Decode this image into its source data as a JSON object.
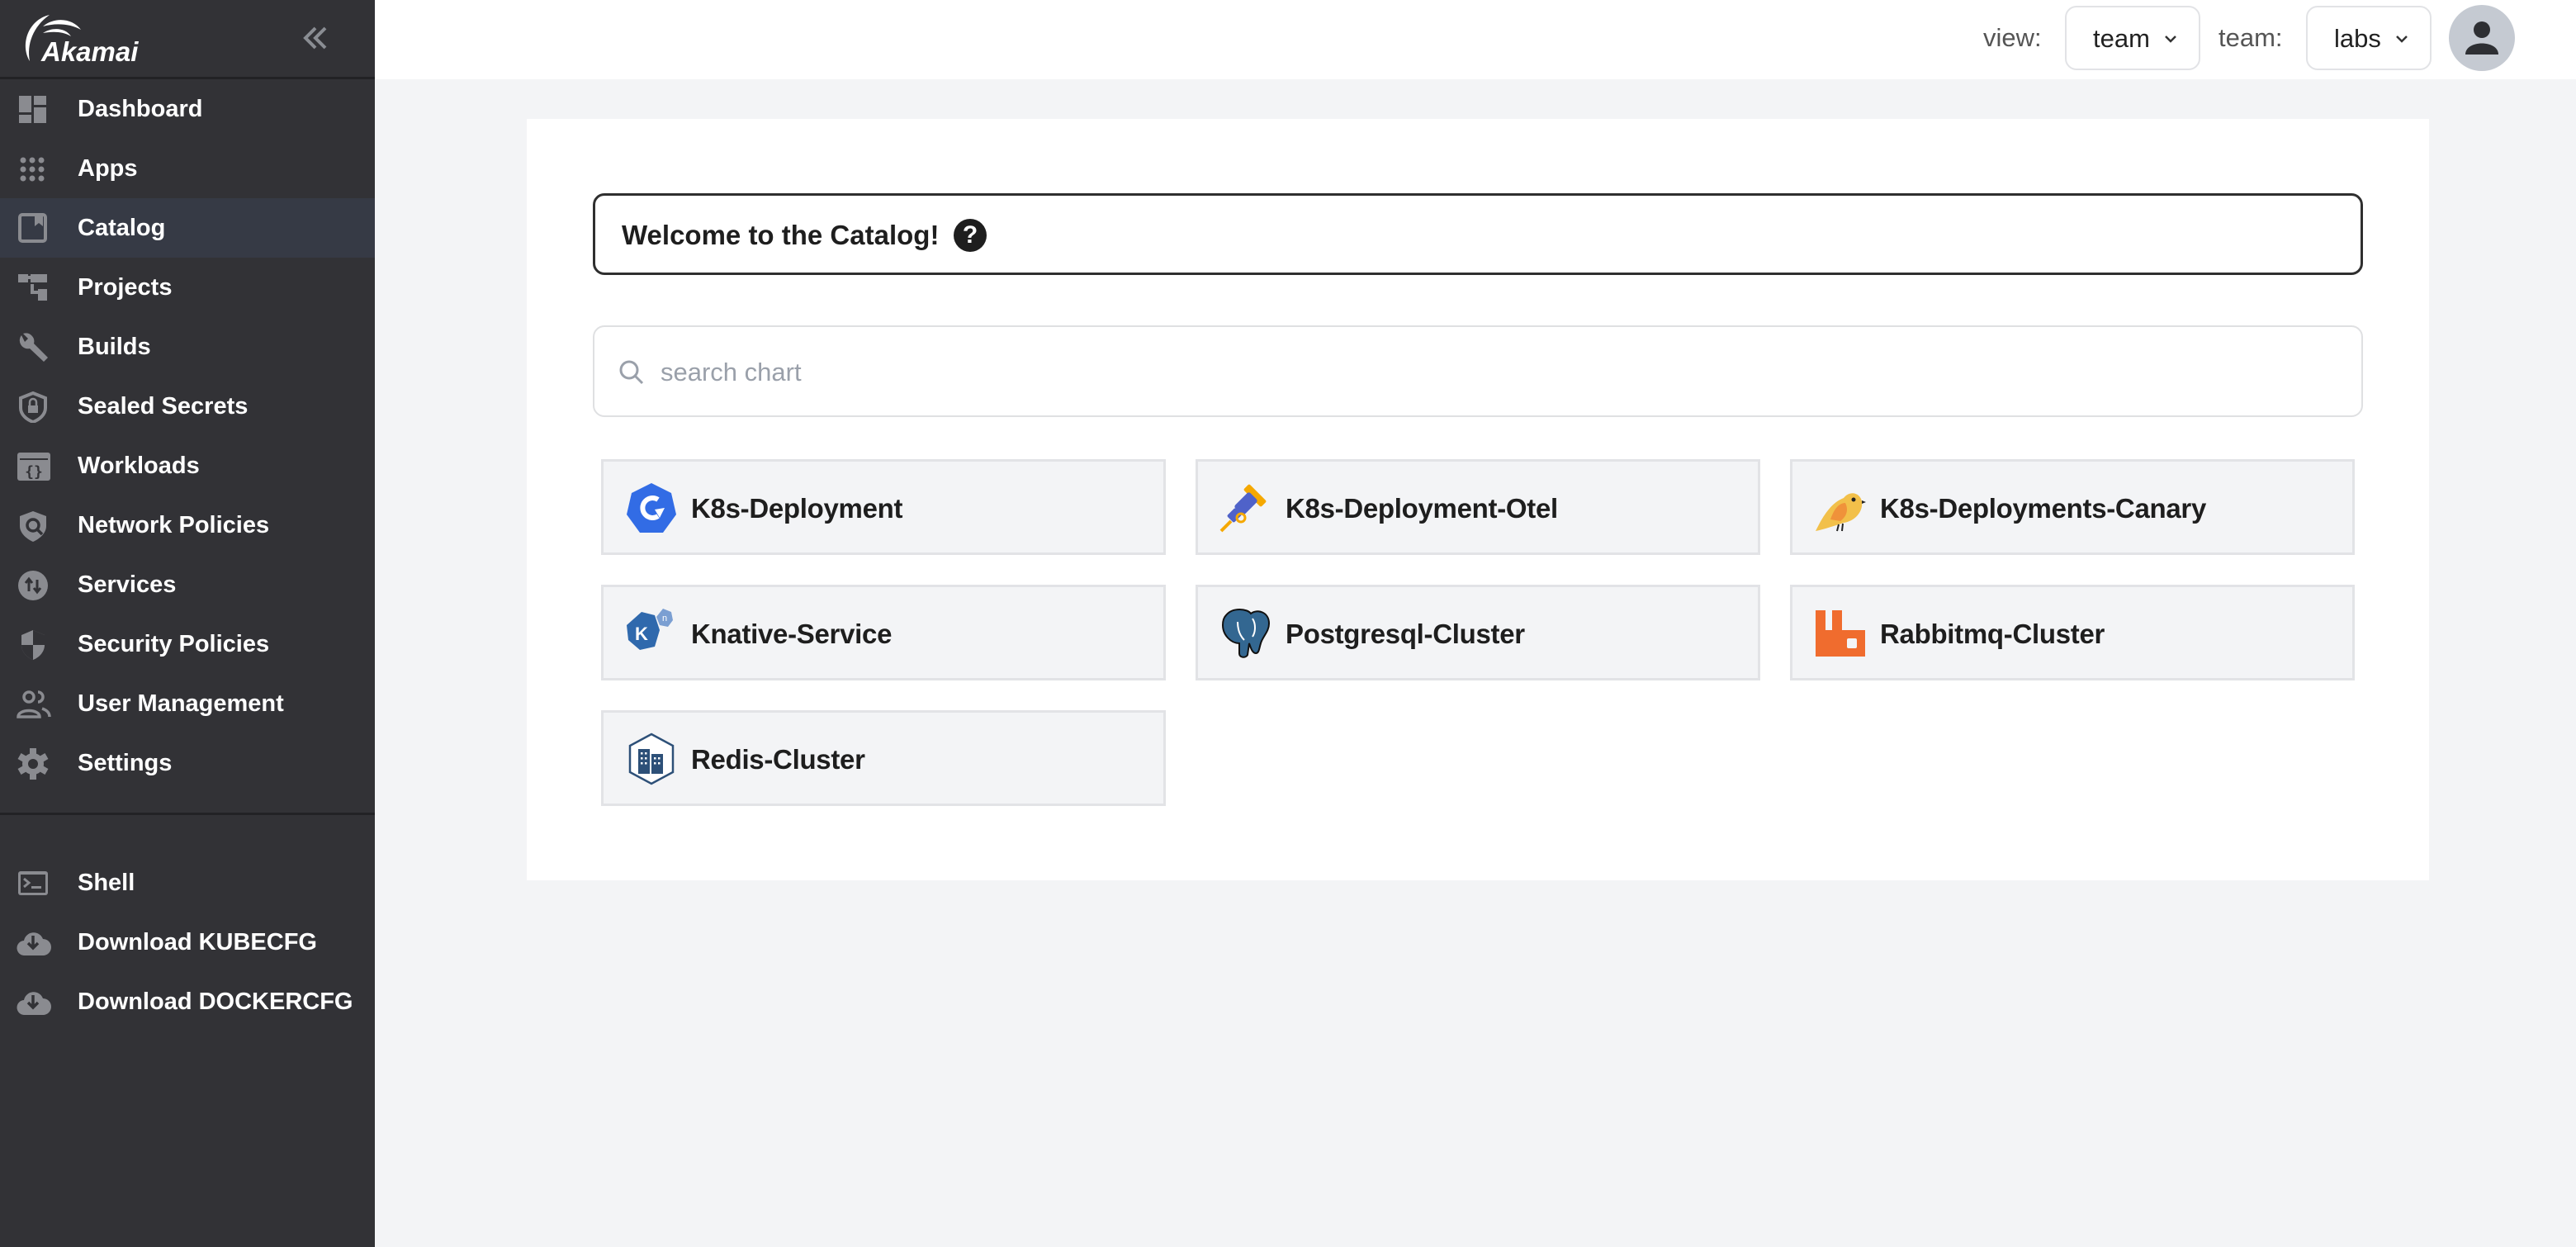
{
  "brand": {
    "name": "Akamai"
  },
  "sidebar": {
    "collapse_label": "«",
    "items": [
      {
        "label": "Dashboard",
        "icon": "dashboard-icon",
        "active": false
      },
      {
        "label": "Apps",
        "icon": "apps-grid-icon",
        "active": false
      },
      {
        "label": "Catalog",
        "icon": "catalog-book-icon",
        "active": true
      },
      {
        "label": "Projects",
        "icon": "projects-tree-icon",
        "active": false
      },
      {
        "label": "Builds",
        "icon": "wrench-icon",
        "active": false
      },
      {
        "label": "Sealed Secrets",
        "icon": "shield-lock-icon",
        "active": false
      },
      {
        "label": "Workloads",
        "icon": "workloads-code-icon",
        "active": false
      },
      {
        "label": "Network Policies",
        "icon": "shield-search-icon",
        "active": false
      },
      {
        "label": "Services",
        "icon": "swap-arrows-icon",
        "active": false
      },
      {
        "label": "Security Policies",
        "icon": "shield-half-icon",
        "active": false
      },
      {
        "label": "User Management",
        "icon": "users-icon",
        "active": false
      },
      {
        "label": "Settings",
        "icon": "gear-icon",
        "active": false
      }
    ],
    "bottom_items": [
      {
        "label": "Shell",
        "icon": "terminal-icon"
      },
      {
        "label": "Download KUBECFG",
        "icon": "cloud-download-icon"
      },
      {
        "label": "Download DOCKERCFG",
        "icon": "cloud-download-icon"
      }
    ]
  },
  "header": {
    "view_label": "view:",
    "view_value": "team",
    "team_label": "team:",
    "team_value": "labs"
  },
  "catalog": {
    "welcome_title": "Welcome to the Catalog!",
    "help_label": "?",
    "search_placeholder": "search chart",
    "search_value": "",
    "charts": [
      {
        "name": "K8s-Deployment",
        "icon": "k8s-deployment-icon",
        "color": "#326ce5"
      },
      {
        "name": "K8s-Deployment-Otel",
        "icon": "opentelemetry-icon",
        "color": "#f5a800"
      },
      {
        "name": "K8s-Deployments-Canary",
        "icon": "canary-bird-icon",
        "color": "#f2c04a"
      },
      {
        "name": "Knative-Service",
        "icon": "knative-icon",
        "color": "#2f69ad"
      },
      {
        "name": "Postgresql-Cluster",
        "icon": "postgresql-elephant-icon",
        "color": "#336791"
      },
      {
        "name": "Rabbitmq-Cluster",
        "icon": "rabbitmq-icon",
        "color": "#f06c2e"
      },
      {
        "name": "Redis-Cluster",
        "icon": "redis-building-icon",
        "color": "#2d5078"
      }
    ]
  }
}
